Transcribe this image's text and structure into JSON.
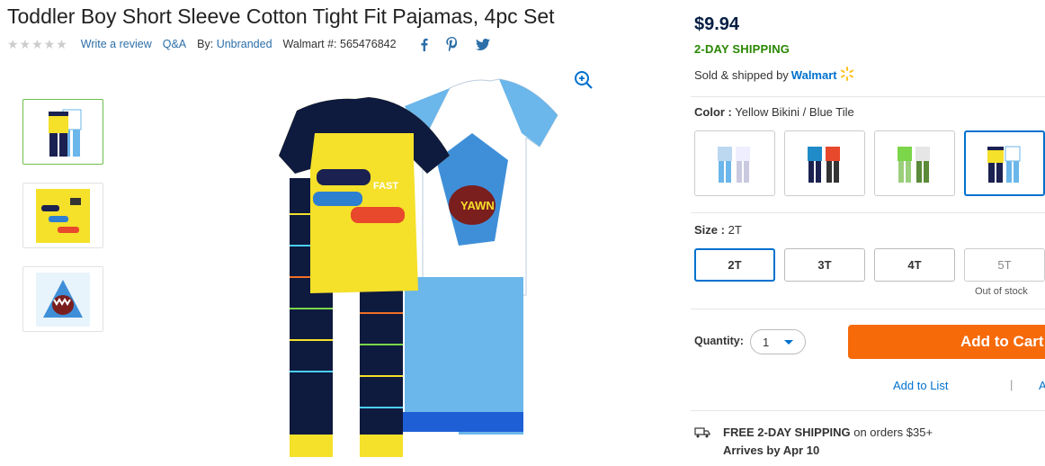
{
  "product": {
    "title": "Toddler Boy Short Sleeve Cotton Tight Fit Pajamas, 4pc Set",
    "stars": "★★★★★",
    "write_review": "Write a review",
    "qa": "Q&A",
    "by_label": "By:",
    "brand": "Unbranded",
    "item_label": "Walmart #:",
    "item_number": "565476842"
  },
  "social": {
    "facebook": "facebook-icon",
    "pinterest": "pinterest-icon",
    "twitter": "twitter-icon"
  },
  "gallery": {
    "thumbnails": [
      "thumbnail-full-set",
      "thumbnail-yellow-shirt",
      "thumbnail-shark-shirt"
    ]
  },
  "buybox": {
    "price": "$9.94",
    "shipping_badge": "2-DAY SHIPPING",
    "sold_prefix": "Sold & shipped by",
    "seller": "Walmart",
    "color_label": "Color :",
    "color_value": "Yellow Bikini / Blue Tile",
    "size_label": "Size :",
    "size_value": "2T",
    "sizes": [
      "2T",
      "3T",
      "4T",
      "5T"
    ],
    "out_of_stock": "Out of stock",
    "quantity_label": "Quantity:",
    "quantity_value": "1",
    "add_to_cart": "Add to Cart",
    "add_to_list": "Add to List",
    "separator": "|",
    "add_to_registry": "A",
    "free_ship_bold": "FREE 2-DAY SHIPPING",
    "free_ship_rest": " on orders $35+",
    "arrives": "Arrives by Apr 10"
  },
  "colors": {
    "accent": "#0071ce",
    "cart": "#f66a0a",
    "green": "#2a8703",
    "navy": "#041e42",
    "spark": "#ffc220"
  }
}
